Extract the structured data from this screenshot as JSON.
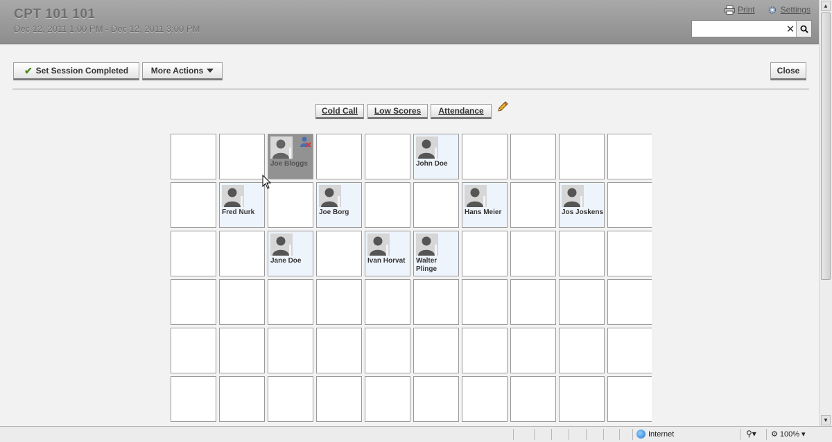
{
  "header": {
    "title": "CPT 101 101",
    "subtitle": "Dec 12, 2011 1:00 PM - Dec 12, 2011 3:00 PM",
    "print_label": "Print",
    "settings_label": "Settings",
    "search_value": ""
  },
  "toolbar": {
    "set_completed_label": "Set Session Completed",
    "more_actions_label": "More Actions",
    "close_label": "Close"
  },
  "views": {
    "cold_call_label": "Cold Call",
    "low_scores_label": "Low Scores",
    "attendance_label": "Attendance"
  },
  "seating": {
    "rows": 6,
    "cols": 10,
    "students": [
      {
        "name": "Joe Bloggs",
        "row": 0,
        "col": 2,
        "state": "dragging",
        "absent": true
      },
      {
        "name": "John Doe",
        "row": 0,
        "col": 5,
        "state": "occupied",
        "absent": false
      },
      {
        "name": "Fred Nurk",
        "row": 1,
        "col": 1,
        "state": "occupied",
        "absent": false
      },
      {
        "name": "Joe Borg",
        "row": 1,
        "col": 3,
        "state": "occupied",
        "absent": false
      },
      {
        "name": "Hans Meier",
        "row": 1,
        "col": 6,
        "state": "occupied",
        "absent": false
      },
      {
        "name": "Jos Joskens",
        "row": 1,
        "col": 8,
        "state": "occupied",
        "absent": false
      },
      {
        "name": "Jane Doe",
        "row": 2,
        "col": 2,
        "state": "occupied",
        "absent": false
      },
      {
        "name": "Ivan Horvat",
        "row": 2,
        "col": 4,
        "state": "occupied",
        "absent": false
      },
      {
        "name": "Walter Plinge",
        "row": 2,
        "col": 5,
        "state": "occupied",
        "absent": false
      }
    ]
  },
  "statusbar": {
    "zone_label": "Internet",
    "zoom_label": "100%"
  },
  "colors": {
    "header_bg": "#9a9a9a",
    "occupied_seat": "#eef4fb",
    "check_green": "#4a8a1a"
  }
}
